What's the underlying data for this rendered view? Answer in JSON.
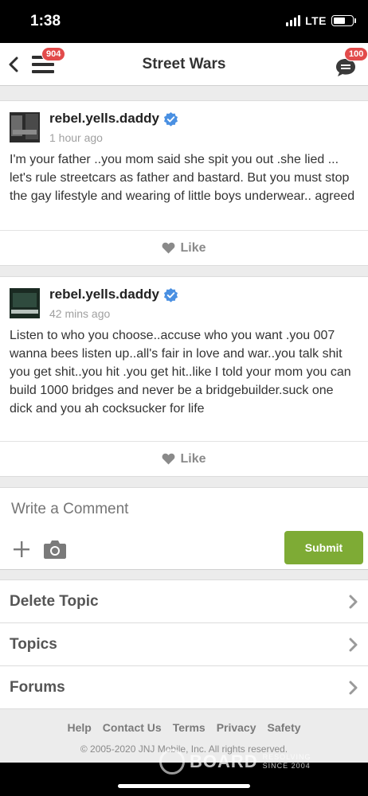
{
  "status_bar": {
    "time": "1:38",
    "network": "LTE"
  },
  "navbar": {
    "title": "Street Wars",
    "menu_badge": "904",
    "chat_badge": "100"
  },
  "posts": [
    {
      "username": "rebel.yells.daddy",
      "timestamp": "1 hour ago",
      "body": "I'm your father ..you mom said she spit you out .she lied ... let's rule streetcars as father and bastard. But you must stop the gay lifestyle and wearing of little boys underwear.. agreed",
      "like_label": "Like"
    },
    {
      "username": "rebel.yells.daddy",
      "timestamp": "42 mins ago",
      "body": "Listen to who you choose..accuse who you want .you 007 wanna bees listen up..all's fair in love and war..you talk shit you get shit..you hit .you get hit..like I told your mom you can build 1000 bridges and never be a bridgebuilder.suck one dick and you ah cocksucker for life",
      "like_label": "Like",
      "avatar_text": "TOP CRYIN"
    }
  ],
  "comment": {
    "placeholder": "Write a Comment",
    "submit_label": "Submit"
  },
  "links": [
    {
      "label": "Delete Topic"
    },
    {
      "label": "Topics"
    },
    {
      "label": "Forums"
    }
  ],
  "footer": {
    "links": [
      "Help",
      "Contact Us",
      "Terms",
      "Privacy",
      "Safety"
    ],
    "copyright": "© 2005-2020 JNJ Mobile, Inc. All rights reserved."
  },
  "watermark": {
    "name": "BOARD",
    "tagline_1": "RESOLVING",
    "tagline_2": "SINCE 2004"
  },
  "colors": {
    "badge": "#e24b4b",
    "submit": "#7eab35",
    "verified": "#4a90e2"
  }
}
